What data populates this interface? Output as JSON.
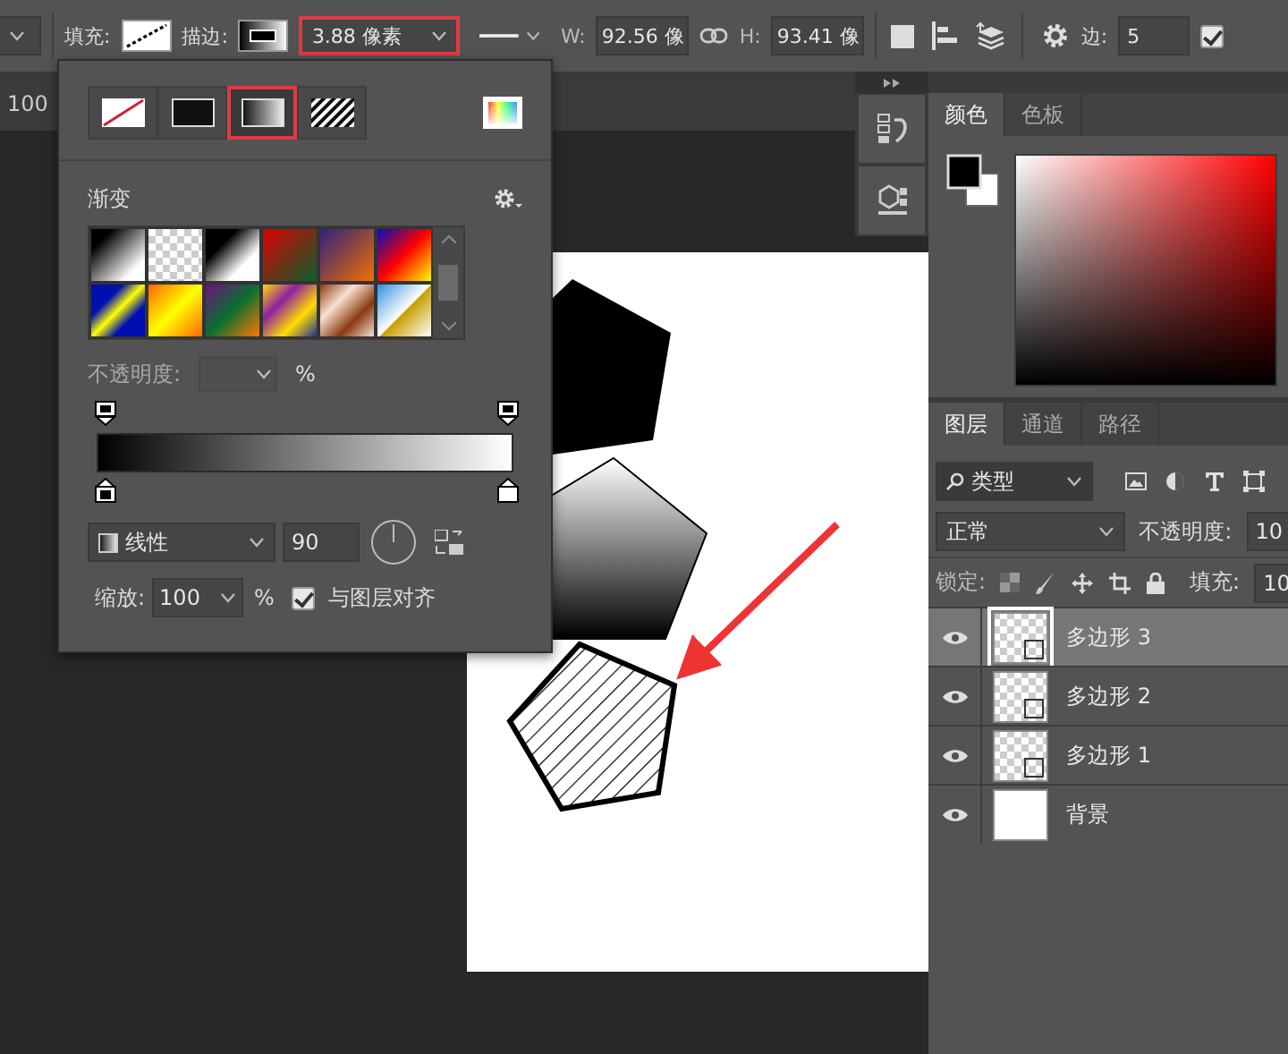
{
  "options_bar": {
    "fill_label": "填充:",
    "stroke_label": "描边:",
    "stroke_width": {
      "value": "3.88 像素",
      "highlighted": true
    },
    "width": {
      "label": "W:",
      "value": "92.56 像"
    },
    "height": {
      "label": "H:",
      "value": "93.41 像"
    },
    "sides": {
      "label": "边:",
      "value": "5"
    },
    "align_edges": {
      "checked": true
    }
  },
  "document_tab": {
    "zoom": "100"
  },
  "fill_popup": {
    "fill_types": [
      {
        "kind": "none",
        "selected": false,
        "highlighted": false
      },
      {
        "kind": "solid",
        "selected": false,
        "highlighted": false
      },
      {
        "kind": "gradient",
        "selected": true,
        "highlighted": true
      },
      {
        "kind": "pattern",
        "selected": false,
        "highlighted": false
      }
    ],
    "section_title": "渐变",
    "opacity": {
      "label": "不透明度:",
      "unit": "%",
      "disabled": true
    },
    "style": {
      "value": "线性"
    },
    "angle": "90",
    "scale": {
      "label": "缩放:",
      "value": "100",
      "unit": "%"
    },
    "align_with_layer": {
      "label": "与图层对齐",
      "checked": true
    }
  },
  "color_panel": {
    "tabs": [
      {
        "label": "颜色",
        "selected": true
      },
      {
        "label": "色板",
        "selected": false
      }
    ]
  },
  "layers_panel": {
    "tabs": [
      {
        "label": "图层",
        "selected": true
      },
      {
        "label": "通道",
        "selected": false
      },
      {
        "label": "路径",
        "selected": false
      }
    ],
    "filter": "类型",
    "blend_mode": "正常",
    "opacity_label": "不透明度:",
    "opacity_value": "10",
    "lock_label": "锁定:",
    "fill_label": "填充:",
    "fill_value": "10",
    "layers": [
      {
        "name": "多边形 3",
        "kind": "shape",
        "selected": true
      },
      {
        "name": "多边形 2",
        "kind": "shape",
        "selected": false
      },
      {
        "name": "多边形 1",
        "kind": "shape",
        "selected": false
      },
      {
        "name": "背景",
        "kind": "background",
        "selected": false
      }
    ]
  }
}
